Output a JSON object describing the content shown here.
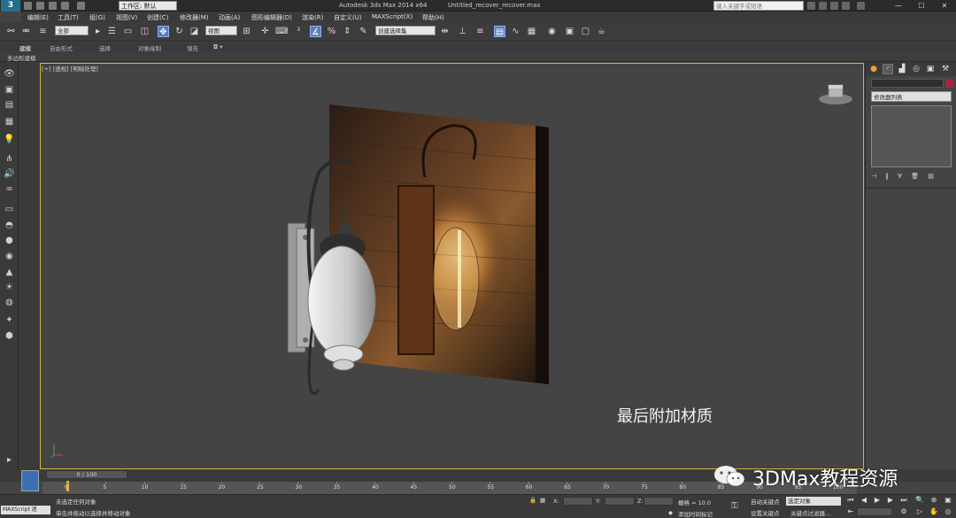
{
  "titlebar": {
    "app_logo": "3",
    "workspace_label": "工作区: 默认",
    "window_title": "Autodesk 3ds Max  2014 x64",
    "file_title": "Untitled_recover_recover.max",
    "help_search_placeholder": "键入关键字或短语",
    "minimize": "—",
    "maximize": "☐",
    "close": "✕"
  },
  "menu": [
    "编辑(E)",
    "工具(T)",
    "组(G)",
    "视图(V)",
    "创建(C)",
    "修改器(M)",
    "动画(A)",
    "图形编辑器(D)",
    "渲染(R)",
    "自定义(U)",
    "MAXScript(X)",
    "帮助(H)"
  ],
  "toolbar": {
    "selection_filter": "全部",
    "reference_coord": "视图",
    "named_selection": "创建选择集"
  },
  "ribbon": {
    "tabs": [
      "建模",
      "自由形式",
      "选择",
      "对象绘制",
      "填充"
    ],
    "active_tab": "建模",
    "sub_label": "多边形建模"
  },
  "viewport": {
    "label": "[+] [透视] [明暗处理]",
    "caption": "最后附加材质"
  },
  "command_panel": {
    "modifier_list": "修改器列表"
  },
  "timeline": {
    "slider_label": "0 / 100",
    "ticks": [
      "0",
      "5",
      "10",
      "15",
      "20",
      "25",
      "30",
      "35",
      "40",
      "45",
      "50",
      "55",
      "60",
      "65",
      "70",
      "75",
      "80",
      "85",
      "90",
      "95",
      "100"
    ]
  },
  "status": {
    "maxscript": "MAXScript 迷",
    "line1": "未选定任何对象",
    "line2": "单击并拖动以选择并移动对象",
    "x_label": "X:",
    "y_label": "Y:",
    "z_label": "Z:",
    "grid": "栅格 = 10.0",
    "add_time_tag": "添加时间标记",
    "auto_key": "自动关键点",
    "set_key": "设置关键点",
    "selected_object": "选定对象",
    "key_filters": "关键点过滤器..."
  },
  "watermark": {
    "text": "3DMax教程资源"
  },
  "colors": {
    "viewport_border": "#d7b33a",
    "active_blue": "#5a7fb5",
    "swatch": "#a0273e"
  }
}
